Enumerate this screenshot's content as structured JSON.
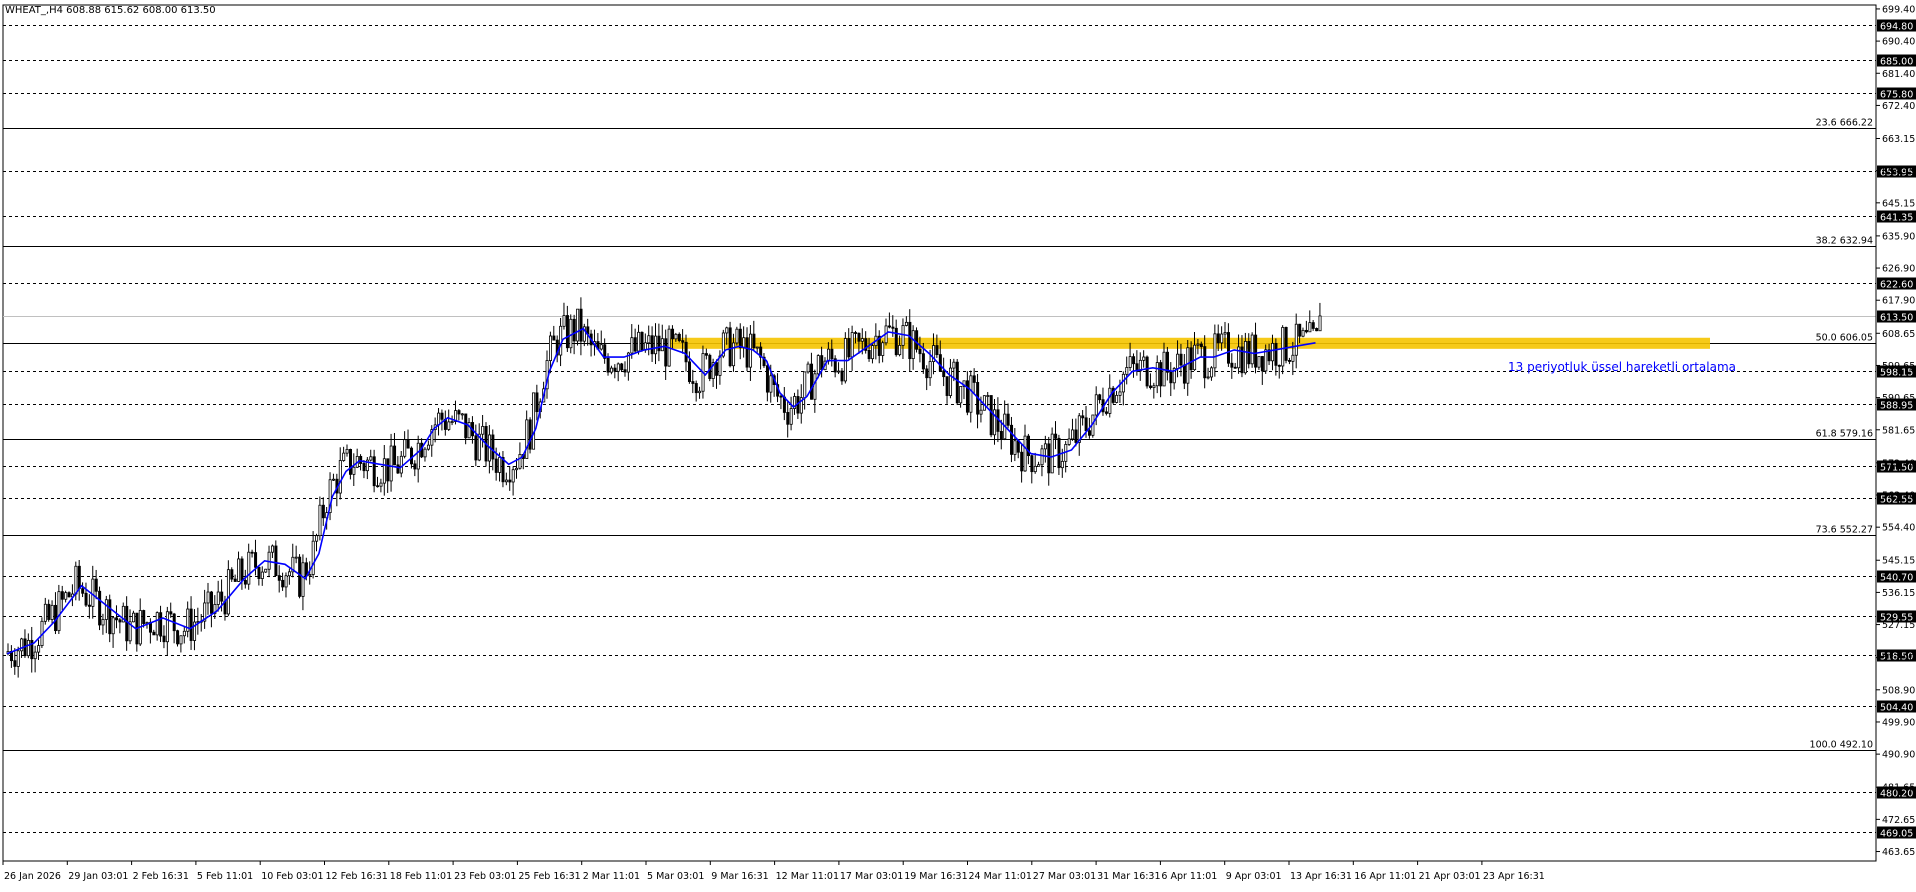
{
  "chart_data": {
    "type": "candlestick",
    "symbol_header": "WHEAT_,H4  608.88 615.62 608.00 613.50",
    "current_price": 613.5,
    "ylim": [
      461.0,
      700.5
    ],
    "y_ticks": [
      699.4,
      690.4,
      681.4,
      672.4,
      663.15,
      654.15,
      645.15,
      635.9,
      626.9,
      617.9,
      608.65,
      599.65,
      590.65,
      581.65,
      572.4,
      563.4,
      554.4,
      545.15,
      536.15,
      527.15,
      517.9,
      508.9,
      499.9,
      490.9,
      481.65,
      472.65,
      463.65
    ],
    "y_tick_labels": [
      "699.40",
      "690.40",
      "681.40",
      "672.40",
      "663.15",
      "654.15",
      "645.15",
      "635.90",
      "626.90",
      "617.90",
      "608.65",
      "599.65",
      "590.65",
      "581.65",
      "572.40",
      "563.40",
      "554.40",
      "545.15",
      "536.15",
      "527.15",
      "517.90",
      "508.90",
      "499.90",
      "490.90",
      "481.65",
      "472.65",
      "463.65"
    ],
    "horizontal_levels": [
      {
        "value": 694.8,
        "label": "694.80"
      },
      {
        "value": 685.0,
        "label": "685.00"
      },
      {
        "value": 675.8,
        "label": "675.80"
      },
      {
        "value": 653.95,
        "label": "653.95"
      },
      {
        "value": 641.35,
        "label": "641.35"
      },
      {
        "value": 622.6,
        "label": "622.60"
      },
      {
        "value": 598.15,
        "label": "598.15"
      },
      {
        "value": 588.95,
        "label": "588.95"
      },
      {
        "value": 571.5,
        "label": "571.50"
      },
      {
        "value": 562.55,
        "label": "562.55"
      },
      {
        "value": 540.7,
        "label": "540.70"
      },
      {
        "value": 529.55,
        "label": "529.55"
      },
      {
        "value": 518.5,
        "label": "518.50"
      },
      {
        "value": 504.4,
        "label": "504.40"
      },
      {
        "value": 480.2,
        "label": "480.20"
      },
      {
        "value": 469.05,
        "label": "469.05"
      }
    ],
    "fibonacci_levels": [
      {
        "value": 666.22,
        "label": "23.6 666.22"
      },
      {
        "value": 632.94,
        "label": "38.2 632.94"
      },
      {
        "value": 606.05,
        "label": "50.0 606.05"
      },
      {
        "value": 579.16,
        "label": "61.8 579.16"
      },
      {
        "value": 552.27,
        "label": "73.6 552.27"
      },
      {
        "value": 492.1,
        "label": "100.0 492.10"
      }
    ],
    "x_labels": [
      "26 Jan 2026",
      "29 Jan 03:01",
      "2 Feb 16:31",
      "5 Feb 11:01",
      "10 Feb 03:01",
      "12 Feb 16:31",
      "18 Feb 11:01",
      "23 Feb 03:01",
      "25 Feb 16:31",
      "2 Mar 11:01",
      "5 Mar 03:01",
      "9 Mar 16:31",
      "12 Mar 11:01",
      "17 Mar 03:01",
      "19 Mar 16:31",
      "24 Mar 11:01",
      "27 Mar 03:01",
      "31 Mar 16:31",
      "6 Apr 11:01",
      "9 Apr 03:01",
      "13 Apr 16:31",
      "16 Apr 11:01",
      "21 Apr 03:01",
      "23 Apr 16:31"
    ],
    "support_zone": {
      "low": 604.3,
      "high": 607.4,
      "color": "#f5c400",
      "label": ""
    },
    "ema_series": {
      "name": "13 periyotluk üssel hareketli ortalama",
      "color": "#0000ff",
      "x_index": [
        0,
        8,
        14,
        22,
        30,
        38,
        46,
        54,
        62,
        70,
        76,
        82,
        88,
        92,
        96,
        100,
        104,
        110,
        116,
        122,
        126,
        130,
        136,
        142,
        148,
        152,
        156,
        160,
        164,
        170,
        176,
        182,
        188,
        194,
        200,
        206,
        212,
        216,
        220,
        224,
        228,
        232,
        236,
        242,
        248,
        254,
        260,
        266,
        272,
        278,
        284,
        290,
        296,
        302,
        308,
        314,
        320,
        326,
        332,
        338,
        344,
        348,
        352,
        356,
        362,
        368,
        374,
        380,
        386,
        392,
        398,
        404,
        410,
        416,
        420,
        424,
        430,
        436
      ],
      "values": [
        519,
        522,
        528,
        538,
        532,
        526,
        529,
        526,
        531,
        540,
        545,
        544,
        540,
        547,
        563,
        570,
        573,
        572,
        571,
        576,
        582,
        585,
        583,
        577,
        572,
        574,
        582,
        598,
        607,
        610,
        602,
        602,
        604,
        605,
        603,
        597,
        604,
        605,
        604,
        601,
        592,
        588,
        591,
        601,
        601,
        605,
        609,
        608,
        603,
        597,
        593,
        587,
        581,
        575,
        574,
        576,
        583,
        592,
        598,
        599,
        598,
        600,
        602,
        602,
        604,
        603,
        604,
        605,
        606
      ]
    }
  },
  "ema_annotation": "13 periyotluk üssel hareketli ortalama",
  "colors": {
    "background": "#ffffff",
    "candle": "#000000",
    "ema": "#0000ff",
    "zone": "#f5c400",
    "annotation": "#0000ff"
  }
}
